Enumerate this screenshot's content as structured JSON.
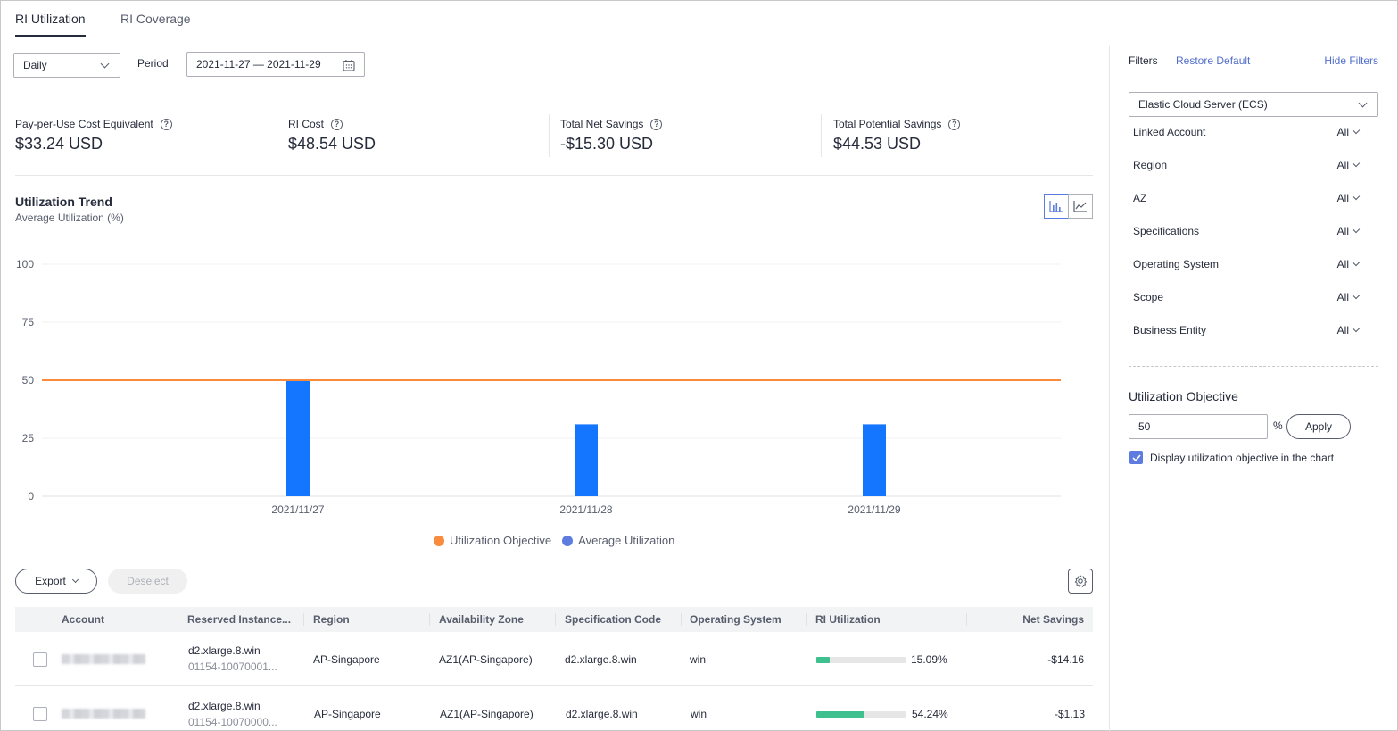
{
  "tabs": [
    {
      "label": "RI Utilization",
      "active": true
    },
    {
      "label": "RI Coverage",
      "active": false
    }
  ],
  "controls": {
    "granularity": "Daily",
    "period_label": "Period",
    "period_value": "2021-11-27 — 2021-11-29"
  },
  "metrics": [
    {
      "label": "Pay-per-Use Cost Equivalent",
      "value": "$33.24 USD"
    },
    {
      "label": "RI Cost",
      "value": "$48.54 USD"
    },
    {
      "label": "Total Net Savings",
      "value": "-$15.30 USD"
    },
    {
      "label": "Total Potential Savings",
      "value": "$44.53 USD"
    }
  ],
  "chart": {
    "title": "Utilization Trend",
    "subtitle": "Average Utilization (%)",
    "legend": [
      {
        "name": "Utilization Objective",
        "color": "#fa8a3c"
      },
      {
        "name": "Average Utilization",
        "color": "#5e7ce0"
      }
    ]
  },
  "chart_data": {
    "type": "bar",
    "categories": [
      "2021/11/27",
      "2021/11/28",
      "2021/11/29"
    ],
    "series": [
      {
        "name": "Average Utilization",
        "values": [
          50,
          31,
          31
        ],
        "color": "#1476ff"
      }
    ],
    "objective": {
      "name": "Utilization Objective",
      "value": 50,
      "color": "#fa8a3c"
    },
    "ylim": [
      0,
      100
    ],
    "yticks": [
      0,
      25,
      50,
      75,
      100
    ],
    "grid": true,
    "legend_position": "bottom-center"
  },
  "table_actions": {
    "export_label": "Export",
    "deselect_label": "Deselect"
  },
  "table": {
    "columns": [
      "Account",
      "Reserved Instance...",
      "Region",
      "Availability Zone",
      "Specification Code",
      "Operating System",
      "RI Utilization",
      "Net Savings"
    ],
    "rows": [
      {
        "ri_name": "d2.xlarge.8.win",
        "ri_id": "01154-10070001...",
        "region": "AP-Singapore",
        "az": "AZ1(AP-Singapore)",
        "spec": "d2.xlarge.8.win",
        "os": "win",
        "utilization": "15.09%",
        "utilization_value": 15.09,
        "net_savings": "-$14.16"
      },
      {
        "ri_name": "d2.xlarge.8.win",
        "ri_id": "01154-10070000...",
        "region": "AP-Singapore",
        "az": "AZ1(AP-Singapore)",
        "spec": "d2.xlarge.8.win",
        "os": "win",
        "utilization": "54.24%",
        "utilization_value": 54.24,
        "net_savings": "-$1.13"
      }
    ]
  },
  "filters": {
    "title": "Filters",
    "restore_label": "Restore Default",
    "hide_label": "Hide Filters",
    "service": "Elastic Cloud Server (ECS)",
    "items": [
      {
        "label": "Linked Account",
        "value": "All"
      },
      {
        "label": "Region",
        "value": "All"
      },
      {
        "label": "AZ",
        "value": "All"
      },
      {
        "label": "Specifications",
        "value": "All"
      },
      {
        "label": "Operating System",
        "value": "All"
      },
      {
        "label": "Scope",
        "value": "All"
      },
      {
        "label": "Business Entity",
        "value": "All"
      }
    ],
    "objective_title": "Utilization Objective",
    "objective_value": "50",
    "objective_unit": "%",
    "apply_label": "Apply",
    "display_checkbox_label": "Display utilization objective in the chart",
    "display_checked": true
  }
}
